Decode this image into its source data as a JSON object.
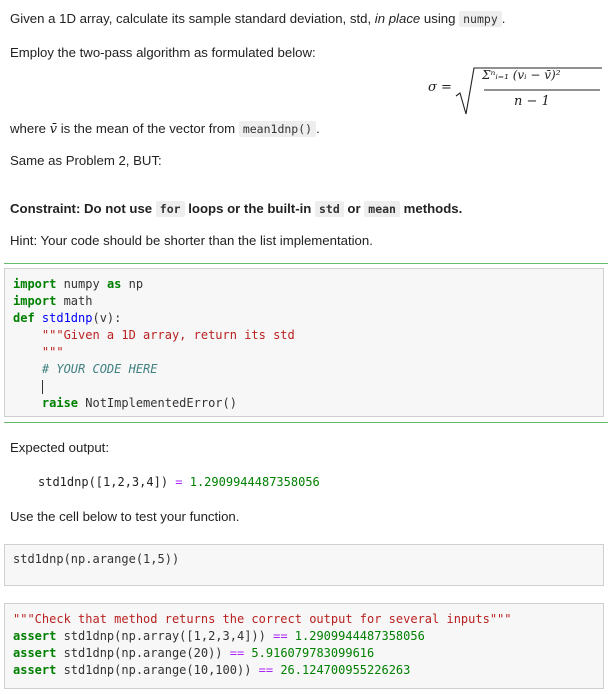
{
  "intro": {
    "line1_a": "Given a 1D array, calculate its sample standard deviation, std, ",
    "line1_italic": "in place",
    "line1_b": " using ",
    "line1_code": "numpy",
    "line1_end": ".",
    "line2": "Employ the two-pass algorithm as formulated below:",
    "line3_a": "where ",
    "line3_vbar": "v̄",
    "line3_b": " is the mean of the vector from ",
    "line3_code": "mean1dnp()",
    "line3_end": ".",
    "line4": "Same as Problem 2, BUT:",
    "constraint_a": "Constraint: Do not use ",
    "constraint_code1": "for",
    "constraint_b": " loops or the built-in ",
    "constraint_code2": "std",
    "constraint_c": " or ",
    "constraint_code3": "mean",
    "constraint_d": " methods.",
    "hint": "Hint: Your code should be shorter than the list implementation."
  },
  "formula": {
    "lhs": "σ =",
    "numerator": "Σⁿᵢ₌₁ (vᵢ − v̄)²",
    "denominator": "n − 1"
  },
  "cell1": {
    "l1_kw": "import",
    "l1_mod": " numpy ",
    "l1_as": "as",
    "l1_np": " np",
    "l2_kw": "import",
    "l2_mod": " math",
    "l3_def": "def",
    "l3_name": " std1dnp",
    "l3_args": "(v):",
    "l4_doc": "    \"\"\"Given a 1D array, return its std",
    "l5_doc": "    \"\"\"",
    "l6_comment": "    # YOUR CODE HERE",
    "l8_raise": "raise",
    "l8_rest": " NotImplementedError()"
  },
  "expected": {
    "label": "Expected output:",
    "call": "std1dnp([1,2,3,4])",
    "eq": " = ",
    "value": "1.2909944487358056"
  },
  "test_hint": "Use the cell below to test your function.",
  "cell2": {
    "line": "std1dnp(np.arange(1,5))"
  },
  "cell3": {
    "doc": "\"\"\"Check that method returns the correct output for several inputs\"\"\"",
    "a1_kw": "assert",
    "a1_expr": " std1dnp(np.array([1,2,3,4])) ",
    "a1_op": "==",
    "a1_val": " 1.2909944487358056",
    "a2_kw": "assert",
    "a2_expr": " std1dnp(np.arange(20)) ",
    "a2_op": "==",
    "a2_val": " 5.916079783099616",
    "a3_kw": "assert",
    "a3_expr": " std1dnp(np.arange(10,100)) ",
    "a3_op": "==",
    "a3_val": " 26.124700955226263"
  }
}
